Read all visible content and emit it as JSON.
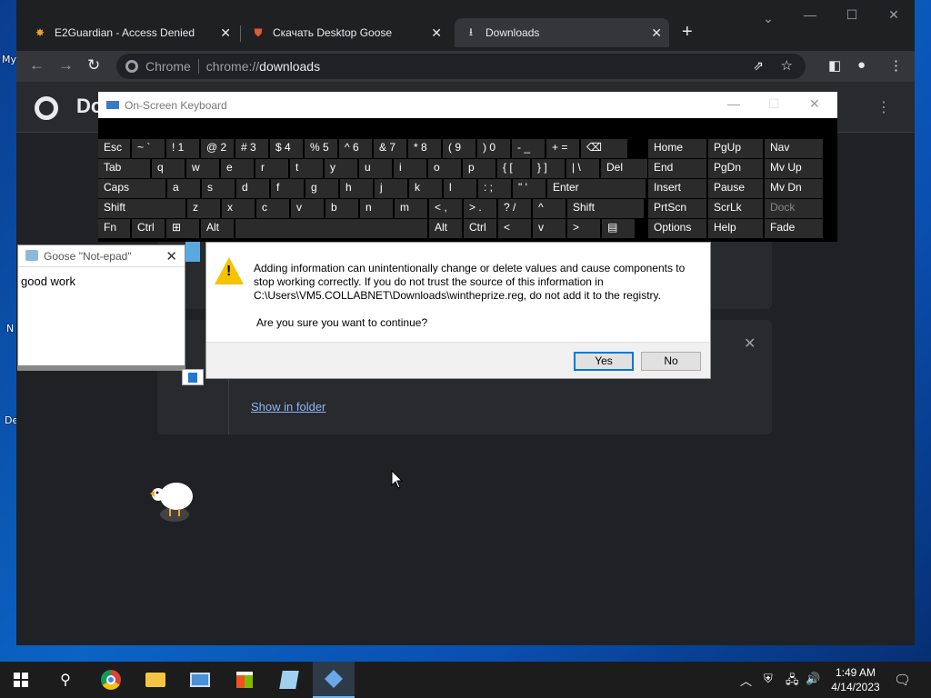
{
  "desktop": {
    "labels": [
      "My",
      "N",
      "De"
    ]
  },
  "browser": {
    "tabs": [
      {
        "title": "E2Guardian - Access Denied",
        "icon": "e2guardian-icon"
      },
      {
        "title": "Скачать Desktop Goose",
        "icon": "shield-icon"
      },
      {
        "title": "Downloads",
        "icon": "download-icon"
      }
    ],
    "omnibox": {
      "label": "Chrome",
      "url_scheme": "chrome://",
      "url_host": "downloads"
    },
    "page": {
      "title": "Doc",
      "show_in_folder": "Show in folder"
    }
  },
  "osk": {
    "title": "On-Screen Keyboard",
    "rows": [
      [
        "Esc",
        "~ `",
        "! 1",
        "@ 2",
        "# 3",
        "$ 4",
        "% 5",
        "^ 6",
        "& 7",
        "* 8",
        "( 9",
        ") 0",
        "- _",
        "+ =",
        "⌫",
        "Home",
        "PgUp",
        "Nav"
      ],
      [
        "Tab",
        "q",
        "w",
        "e",
        "r",
        "t",
        "y",
        "u",
        "i",
        "o",
        "p",
        "{ [",
        "} ]",
        "| \\",
        "Del",
        "End",
        "PgDn",
        "Mv Up"
      ],
      [
        "Caps",
        "a",
        "s",
        "d",
        "f",
        "g",
        "h",
        "j",
        "k",
        "l",
        ": ;",
        "\" '",
        "Enter",
        "Insert",
        "Pause",
        "Mv Dn"
      ],
      [
        "Shift",
        "z",
        "x",
        "c",
        "v",
        "b",
        "n",
        "m",
        "< ,",
        "> .",
        "? /",
        "^",
        "Shift",
        "PrtScn",
        "ScrLk",
        "Dock"
      ],
      [
        "Fn",
        "Ctrl",
        "⊞",
        "Alt",
        "",
        "Alt",
        "Ctrl",
        "<",
        "v",
        ">",
        "▤",
        "Options",
        "Help",
        "Fade"
      ]
    ]
  },
  "notepad": {
    "title": "Goose \"Not-epad\"",
    "text": "good work"
  },
  "dialog": {
    "message": "Adding information can unintentionally change or delete values and cause components to stop working correctly. If you do not trust the source of this information in C:\\Users\\VM5.COLLABNET\\Downloads\\wintheprize.reg, do not add it to the registry.",
    "question": "Are you sure you want to continue?",
    "yes_label": "Yes",
    "no_label": "No"
  },
  "taskbar": {
    "time": "1:49 AM",
    "date": "4/14/2023"
  }
}
